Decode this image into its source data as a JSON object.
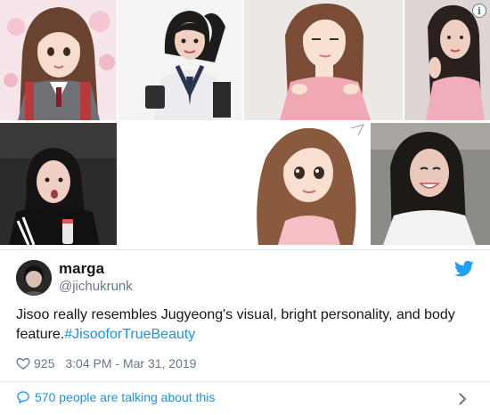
{
  "tweet": {
    "display_name": "marga",
    "handle": "@jichukrunk",
    "text_main": "Jisoo really resembles Jugyeong's visual, bright personality, and body feature.",
    "hashtag": "#JisooforTrueBeauty",
    "likes": "925",
    "timestamp": "3:04 PM - Mar 31, 2019",
    "talking": "570 people are talking about this"
  },
  "media": {
    "info_glyph": "i",
    "photos": [
      {
        "name": "webtoon-school-uniform-art"
      },
      {
        "name": "jisoo-school-uniform-photo"
      },
      {
        "name": "webtoon-pink-top-art"
      },
      {
        "name": "jisoo-pink-top-photo"
      },
      {
        "name": "jisoo-black-jacket-photo"
      },
      {
        "name": "webtoon-wavy-hair-art"
      },
      {
        "name": "jisoo-smiling-photo"
      }
    ]
  },
  "icons": {
    "like": "heart-icon",
    "reply": "speech-bubble-icon",
    "brand": "twitter-bird-icon",
    "more": "chevron-right-icon"
  },
  "colors": {
    "link": "#1b95e0",
    "secondary_text": "#657786",
    "primary_text": "#14171a",
    "divider": "#e1e8ed"
  }
}
